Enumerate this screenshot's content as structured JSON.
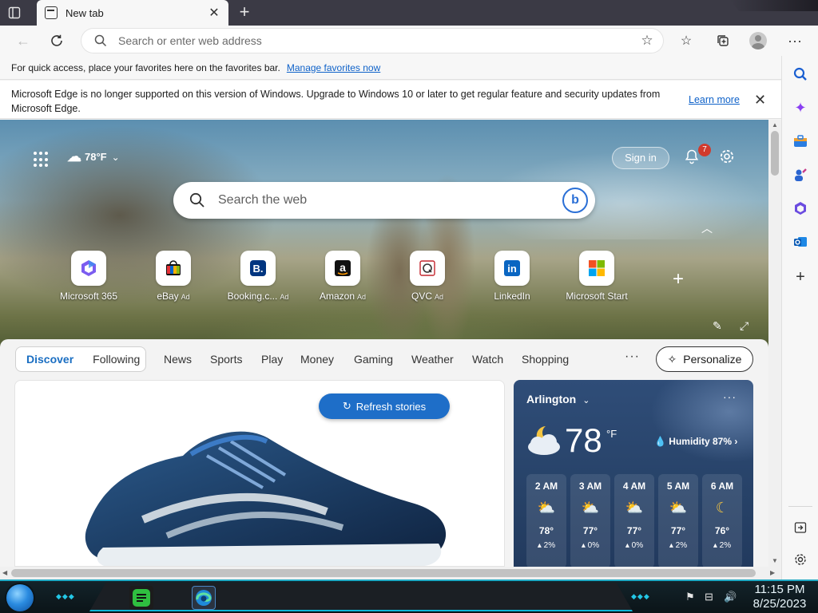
{
  "browser": {
    "tab_title": "New tab",
    "address_placeholder": "Search or enter web address"
  },
  "favbar": {
    "text": "For quick access, place your favorites here on the favorites bar.",
    "link": "Manage favorites now"
  },
  "infobar": {
    "message": "Microsoft Edge is no longer supported on this version of Windows. Upgrade to Windows 10 or later to get regular feature and security updates from Microsoft Edge.",
    "learn_more": "Learn more"
  },
  "hero": {
    "weather_temp": "78°F",
    "sign_in": "Sign in",
    "notifications": "7",
    "search_placeholder": "Search the web"
  },
  "quick_links": [
    {
      "label": "Microsoft 365",
      "ad": ""
    },
    {
      "label": "eBay",
      "ad": "Ad"
    },
    {
      "label": "Booking.c...",
      "ad": "Ad"
    },
    {
      "label": "Amazon",
      "ad": "Ad"
    },
    {
      "label": "QVC",
      "ad": "Ad"
    },
    {
      "label": "LinkedIn",
      "ad": ""
    },
    {
      "label": "Microsoft Start",
      "ad": ""
    }
  ],
  "feed": {
    "discover": "Discover",
    "following": "Following",
    "tabs": [
      "News",
      "Sports",
      "Play",
      "Money",
      "Gaming",
      "Weather",
      "Watch",
      "Shopping"
    ],
    "more": "···",
    "personalize": "Personalize",
    "refresh": "Refresh stories"
  },
  "weather": {
    "city": "Arlington",
    "temp": "78",
    "unit": "°F",
    "humidity": "Humidity 87%",
    "hours": [
      {
        "time": "2 AM",
        "temp": "78°",
        "precip": "2%"
      },
      {
        "time": "3 AM",
        "temp": "77°",
        "precip": "0%"
      },
      {
        "time": "4 AM",
        "temp": "77°",
        "precip": "0%"
      },
      {
        "time": "5 AM",
        "temp": "77°",
        "precip": "2%"
      },
      {
        "time": "6 AM",
        "temp": "76°",
        "precip": "2%"
      }
    ]
  },
  "taskbar": {
    "time": "11:15 PM",
    "date": "8/25/2023"
  },
  "colors": {
    "accent": "#1e6ec8",
    "taskbar_glow": "#20a9c4",
    "badge": "#d13a2c"
  }
}
